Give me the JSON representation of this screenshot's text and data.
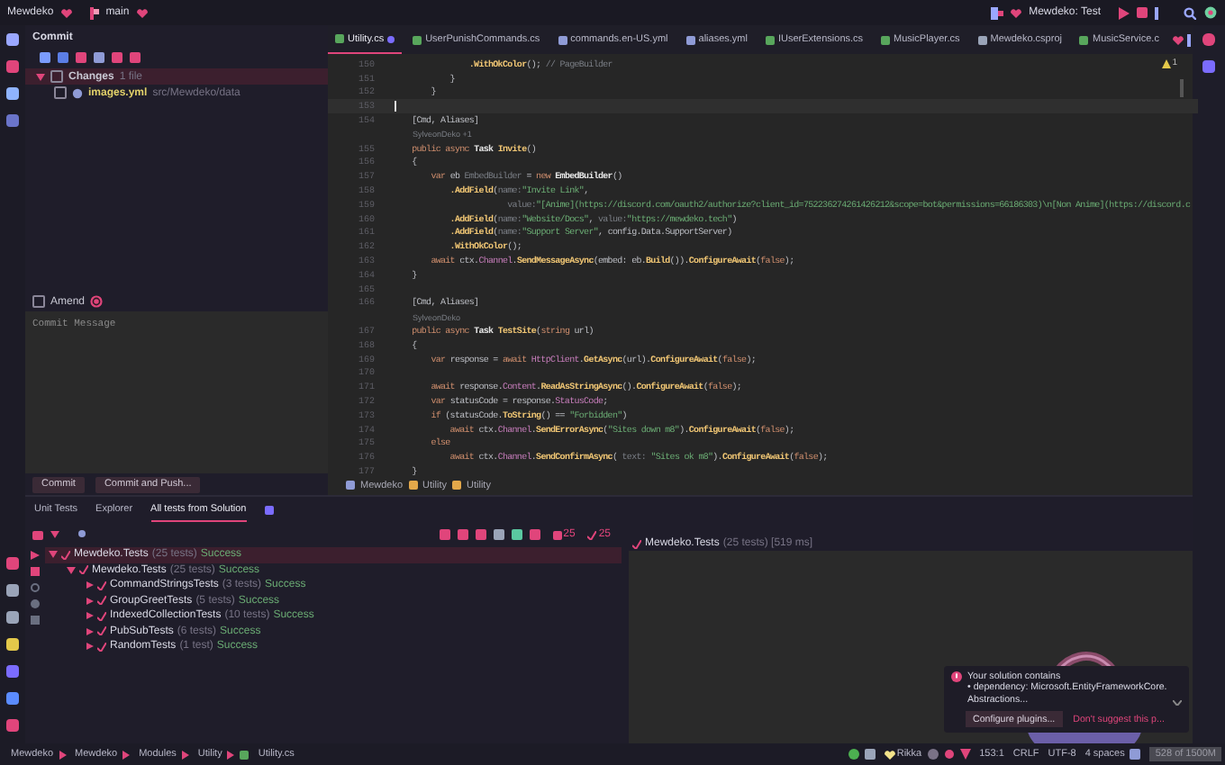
{
  "top_bar": {
    "project": "Mewdeko",
    "branch": "main",
    "run_config": "Mewdeko: Test"
  },
  "commit_panel": {
    "title": "Commit",
    "changes": {
      "label": "Changes",
      "count": "1 file",
      "expanded": true,
      "checked": false,
      "files": [
        {
          "name": "images.yml",
          "path": "src/Mewdeko/data",
          "checked": false
        }
      ]
    },
    "amend": {
      "label": "Amend",
      "checked": false
    },
    "message_placeholder": "Commit Message",
    "buttons": [
      "Commit",
      "Commit and Push..."
    ]
  },
  "editor": {
    "tabs": [
      {
        "label": "Utility.cs",
        "kind": "cs",
        "selected": true,
        "modified": true
      },
      {
        "label": "UserPunishCommands.cs",
        "kind": "cs",
        "selected": false,
        "modified": false
      },
      {
        "label": "commands.en-US.yml",
        "kind": "yml",
        "selected": false,
        "modified": false
      },
      {
        "label": "aliases.yml",
        "kind": "yml",
        "selected": false,
        "modified": false
      },
      {
        "label": "IUserExtensions.cs",
        "kind": "cs",
        "selected": false,
        "modified": false
      },
      {
        "label": "MusicPlayer.cs",
        "kind": "cs",
        "selected": false,
        "modified": false
      },
      {
        "label": "Mewdeko.csproj",
        "kind": "proj",
        "selected": false,
        "modified": false
      },
      {
        "label": "MusicService.c",
        "kind": "cs",
        "selected": false,
        "modified": false
      }
    ],
    "warnings": "1",
    "lines": [
      {
        "number": "150",
        "current": false,
        "t": [
          {
            "kind": "method",
            "text": "                .WithOkColor"
          },
          {
            "kind": "plain",
            "text": "();"
          },
          {
            "kind": "hint",
            "text": " // PageBuilder"
          }
        ]
      },
      {
        "number": "151",
        "current": false,
        "t": [
          {
            "kind": "plain",
            "text": "            }"
          }
        ]
      },
      {
        "number": "152",
        "current": false,
        "t": [
          {
            "kind": "plain",
            "text": "        }"
          }
        ]
      },
      {
        "number": "153",
        "current": true
      },
      {
        "number": "154",
        "current": false,
        "t": [
          {
            "kind": "plain",
            "text": "    [Cmd, Aliases]"
          }
        ]
      },
      {
        "kind": "hint",
        "text": "SylveonDeko +1"
      },
      {
        "number": "155",
        "current": false,
        "t": [
          {
            "kind": "kw",
            "text": "    public async "
          },
          {
            "kind": "type",
            "text": "Task "
          },
          {
            "kind": "method",
            "text": "Invite"
          },
          {
            "kind": "plain",
            "text": "()"
          }
        ]
      },
      {
        "number": "156",
        "current": false,
        "t": [
          {
            "kind": "plain",
            "text": "    {"
          }
        ]
      },
      {
        "number": "157",
        "current": false,
        "t": [
          {
            "kind": "kw",
            "text": "        var "
          },
          {
            "kind": "plain",
            "text": "eb"
          },
          {
            "kind": "hint",
            "text": " EmbedBuilder"
          },
          {
            "kind": "plain",
            "text": " = "
          },
          {
            "kind": "kw",
            "text": "new "
          },
          {
            "kind": "type",
            "text": "EmbedBuilder"
          },
          {
            "kind": "plain",
            "text": "()"
          }
        ]
      },
      {
        "number": "158",
        "current": false,
        "t": [
          {
            "kind": "method",
            "text": "            .AddField"
          },
          {
            "kind": "plain",
            "text": "("
          },
          {
            "kind": "hint",
            "text": "name:"
          },
          {
            "kind": "str",
            "text": "\"Invite Link\""
          },
          {
            "kind": "plain",
            "text": ","
          }
        ]
      },
      {
        "number": "159",
        "current": false,
        "t": [
          {
            "kind": "hint",
            "text": "                        value:"
          },
          {
            "kind": "str",
            "text": "\"[Anime](https://discord.com/oauth2/authorize?client_id=752236274261426212&scope=bot&permissions=66186303)\\n[Non Anime](https://discord.c"
          }
        ]
      },
      {
        "number": "160",
        "current": false,
        "t": [
          {
            "kind": "method",
            "text": "            .AddField"
          },
          {
            "kind": "plain",
            "text": "("
          },
          {
            "kind": "hint",
            "text": "name:"
          },
          {
            "kind": "str",
            "text": "\"Website/Docs\""
          },
          {
            "kind": "plain",
            "text": ", "
          },
          {
            "kind": "hint",
            "text": "value:"
          },
          {
            "kind": "str",
            "text": "\"https://mewdeko.tech\""
          },
          {
            "kind": "plain",
            "text": ")"
          }
        ]
      },
      {
        "number": "161",
        "current": false,
        "t": [
          {
            "kind": "method",
            "text": "            .AddField"
          },
          {
            "kind": "plain",
            "text": "("
          },
          {
            "kind": "hint",
            "text": "name:"
          },
          {
            "kind": "str",
            "text": "\"Support Server\""
          },
          {
            "kind": "plain",
            "text": ", config.Data.SupportServer)"
          }
        ]
      },
      {
        "number": "162",
        "current": false,
        "t": [
          {
            "kind": "method",
            "text": "            .WithOkColor"
          },
          {
            "kind": "plain",
            "text": "();"
          }
        ]
      },
      {
        "number": "163",
        "current": false,
        "t": [
          {
            "kind": "kw",
            "text": "        await "
          },
          {
            "kind": "plain",
            "text": "ctx."
          },
          {
            "kind": "field",
            "text": "Channel"
          },
          {
            "kind": "plain",
            "text": "."
          },
          {
            "kind": "method",
            "text": "SendMessageAsync"
          },
          {
            "kind": "plain",
            "text": "(embed: eb."
          },
          {
            "kind": "method",
            "text": "Build"
          },
          {
            "kind": "plain",
            "text": "())."
          },
          {
            "kind": "method",
            "text": "ConfigureAwait"
          },
          {
            "kind": "plain",
            "text": "("
          },
          {
            "kind": "kw",
            "text": "false"
          },
          {
            "kind": "plain",
            "text": ");"
          }
        ]
      },
      {
        "number": "164",
        "current": false,
        "t": [
          {
            "kind": "plain",
            "text": "    }"
          }
        ]
      },
      {
        "number": "165",
        "current": false
      },
      {
        "number": "166",
        "current": false,
        "t": [
          {
            "kind": "plain",
            "text": "    [Cmd, Aliases]"
          }
        ]
      },
      {
        "kind": "hint",
        "text": "SylveonDeko"
      },
      {
        "number": "167",
        "current": false,
        "t": [
          {
            "kind": "kw",
            "text": "    public async "
          },
          {
            "kind": "type",
            "text": "Task "
          },
          {
            "kind": "method",
            "text": "TestSite"
          },
          {
            "kind": "plain",
            "text": "("
          },
          {
            "kind": "kw",
            "text": "string "
          },
          {
            "kind": "plain",
            "text": "url)"
          }
        ]
      },
      {
        "number": "168",
        "current": false,
        "t": [
          {
            "kind": "plain",
            "text": "    {"
          }
        ]
      },
      {
        "number": "169",
        "current": false,
        "t": [
          {
            "kind": "kw",
            "text": "        var "
          },
          {
            "kind": "plain",
            "text": "response = "
          },
          {
            "kind": "kw",
            "text": "await "
          },
          {
            "kind": "field",
            "text": "HttpClient"
          },
          {
            "kind": "plain",
            "text": "."
          },
          {
            "kind": "method",
            "text": "GetAsync"
          },
          {
            "kind": "plain",
            "text": "(url)."
          },
          {
            "kind": "method",
            "text": "ConfigureAwait"
          },
          {
            "kind": "plain",
            "text": "("
          },
          {
            "kind": "kw",
            "text": "false"
          },
          {
            "kind": "plain",
            "text": ");"
          }
        ]
      },
      {
        "number": "170",
        "current": false
      },
      {
        "number": "171",
        "current": false,
        "t": [
          {
            "kind": "kw",
            "text": "        await "
          },
          {
            "kind": "plain",
            "text": "response."
          },
          {
            "kind": "field",
            "text": "Content"
          },
          {
            "kind": "plain",
            "text": "."
          },
          {
            "kind": "method",
            "text": "ReadAsStringAsync"
          },
          {
            "kind": "plain",
            "text": "()."
          },
          {
            "kind": "method",
            "text": "ConfigureAwait"
          },
          {
            "kind": "plain",
            "text": "("
          },
          {
            "kind": "kw",
            "text": "false"
          },
          {
            "kind": "plain",
            "text": ");"
          }
        ]
      },
      {
        "number": "172",
        "current": false,
        "t": [
          {
            "kind": "kw",
            "text": "        var "
          },
          {
            "kind": "plain",
            "text": "statusCode = response."
          },
          {
            "kind": "field",
            "text": "StatusCode"
          },
          {
            "kind": "plain",
            "text": ";"
          }
        ]
      },
      {
        "number": "173",
        "current": false,
        "t": [
          {
            "kind": "kw",
            "text": "        if "
          },
          {
            "kind": "plain",
            "text": "(statusCode."
          },
          {
            "kind": "method",
            "text": "ToString"
          },
          {
            "kind": "plain",
            "text": "() == "
          },
          {
            "kind": "str",
            "text": "\"Forbidden\""
          },
          {
            "kind": "plain",
            "text": ")"
          }
        ]
      },
      {
        "number": "174",
        "current": false,
        "t": [
          {
            "kind": "kw",
            "text": "            await "
          },
          {
            "kind": "plain",
            "text": "ctx."
          },
          {
            "kind": "field",
            "text": "Channel"
          },
          {
            "kind": "plain",
            "text": "."
          },
          {
            "kind": "method",
            "text": "SendErrorAsync"
          },
          {
            "kind": "plain",
            "text": "("
          },
          {
            "kind": "str",
            "text": "\"Sites down m8\""
          },
          {
            "kind": "plain",
            "text": ")."
          },
          {
            "kind": "method",
            "text": "ConfigureAwait"
          },
          {
            "kind": "plain",
            "text": "("
          },
          {
            "kind": "kw",
            "text": "false"
          },
          {
            "kind": "plain",
            "text": ");"
          }
        ]
      },
      {
        "number": "175",
        "current": false,
        "t": [
          {
            "kind": "kw",
            "text": "        else"
          }
        ]
      },
      {
        "number": "176",
        "current": false,
        "t": [
          {
            "kind": "kw",
            "text": "            await "
          },
          {
            "kind": "plain",
            "text": "ctx."
          },
          {
            "kind": "field",
            "text": "Channel"
          },
          {
            "kind": "plain",
            "text": "."
          },
          {
            "kind": "method",
            "text": "SendConfirmAsync"
          },
          {
            "kind": "plain",
            "text": "( "
          },
          {
            "kind": "hint",
            "text": "text: "
          },
          {
            "kind": "str",
            "text": "\"Sites ok m8\""
          },
          {
            "kind": "plain",
            "text": ")."
          },
          {
            "kind": "method",
            "text": "ConfigureAwait"
          },
          {
            "kind": "plain",
            "text": "("
          },
          {
            "kind": "kw",
            "text": "false"
          },
          {
            "kind": "plain",
            "text": ");"
          }
        ]
      },
      {
        "number": "177",
        "current": false,
        "t": [
          {
            "kind": "plain",
            "text": "    }"
          }
        ]
      }
    ],
    "breadcrumb": [
      "Mewdeko",
      "Utility",
      "Utility"
    ]
  },
  "test_panel": {
    "tabs": [
      {
        "label": "Unit Tests",
        "selected": false
      },
      {
        "label": "Explorer",
        "selected": false
      },
      {
        "label": "All tests from Solution",
        "selected": true
      }
    ],
    "counters": [
      {
        "kind": "total",
        "text": "25"
      },
      {
        "kind": "passed",
        "text": "25"
      }
    ],
    "tree": [
      {
        "name": "Mewdeko.Tests",
        "detail": "(25 tests)",
        "status": "Success",
        "expanded": true,
        "selected": true,
        "children": [
          {
            "name": "Mewdeko.Tests",
            "detail": "(25 tests)",
            "status": "Success",
            "expanded": true,
            "selected": false,
            "children": [
              {
                "name": "CommandStringsTests",
                "detail": "(3 tests)",
                "status": "Success",
                "expanded": false,
                "selected": false
              },
              {
                "name": "GroupGreetTests",
                "detail": "(5 tests)",
                "status": "Success",
                "expanded": false,
                "selected": false
              },
              {
                "name": "IndexedCollectionTests",
                "detail": "(10 tests)",
                "status": "Success",
                "expanded": false,
                "selected": false
              },
              {
                "name": "PubSubTests",
                "detail": "(6 tests)",
                "status": "Success",
                "expanded": false,
                "selected": false
              },
              {
                "name": "RandomTests",
                "detail": "(1 test)",
                "status": "Success",
                "expanded": false,
                "selected": false
              }
            ]
          }
        ]
      }
    ],
    "result": {
      "name": "Mewdeko.Tests",
      "detail": "(25 tests) [519 ms]"
    },
    "notification": {
      "lines": [
        "Your solution contains",
        "• dependency: Microsoft.EntityFrameworkCore.",
        "Abstractions..."
      ],
      "actions": [
        "Configure plugins...",
        "Don't suggest this p..."
      ]
    }
  },
  "status_bar": {
    "path": [
      "Mewdeko",
      "Mewdeko",
      "Modules",
      "Utility",
      "Utility.cs"
    ],
    "user": "Rikka",
    "position": "153:1",
    "line_ending": "CRLF",
    "encoding": "UTF-8",
    "indent": "4 spaces",
    "memory": "528 of 1500M"
  }
}
